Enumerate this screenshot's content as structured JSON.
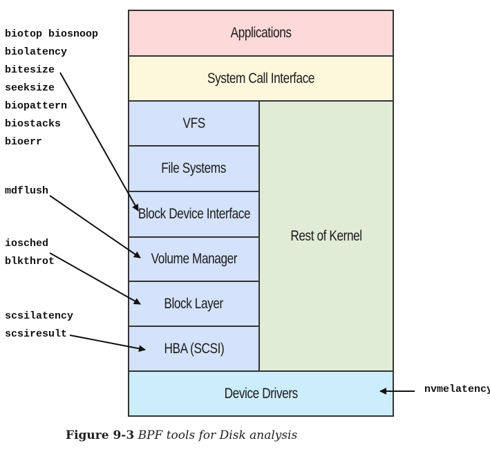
{
  "diagram": {
    "layers": {
      "applications": "Applications",
      "syscall": "System Call Interface",
      "vfs": "VFS",
      "filesystems": "File Systems",
      "block_device_interface": "Block Device Interface",
      "volume_manager": "Volume Manager",
      "block_layer": "Block Layer",
      "hba": "HBA (SCSI)",
      "rest_of_kernel": "Rest of Kernel",
      "device_drivers": "Device Drivers"
    },
    "colors": {
      "applications": "#fdd9d9",
      "syscall": "#fdf8dc",
      "storage_stack": "#d4e2fb",
      "rest_of_kernel": "#e0ecd6",
      "device_drivers": "#ccedfb"
    },
    "tool_groups": {
      "block_device": "biotop biosnoop\nbiolatency\nbitesize\nseeksize\nbiopattern\nbiostacks\nbioerr",
      "volume_manager": "mdflush",
      "block_layer": "iosched\nblkthrot",
      "hba": "scsilatency\nscsiresult",
      "device_drivers": "nvmelatency"
    }
  },
  "caption": {
    "label": "Figure 9-3",
    "text": "BPF tools for Disk analysis"
  }
}
